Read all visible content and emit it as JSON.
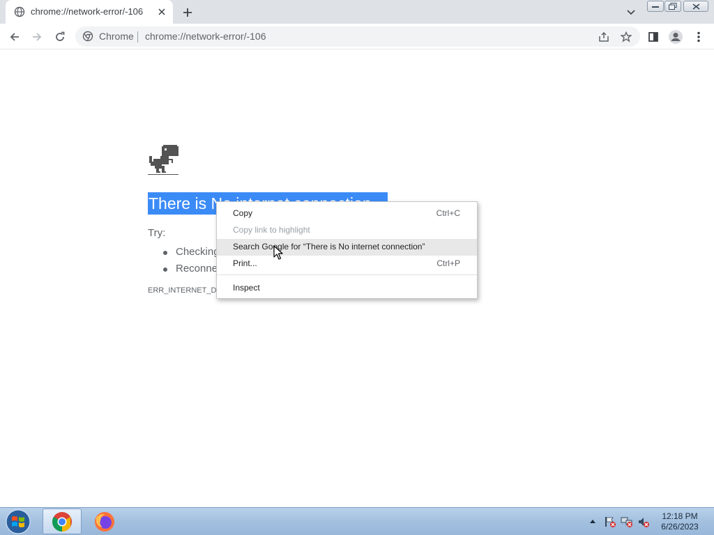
{
  "browser": {
    "tab": {
      "title": "chrome://network-error/-106",
      "favicon": "globe-icon"
    },
    "omnibox": {
      "chip": "Chrome",
      "url": "chrome://network-error/-106"
    },
    "icons": {
      "back": "arrow-left-icon",
      "forward": "arrow-right-icon",
      "reload": "reload-icon",
      "share": "share-icon",
      "bookmark": "star-icon",
      "side_panel": "side-panel-icon",
      "profile": "profile-icon",
      "menu": "kebab-menu-icon"
    }
  },
  "page": {
    "heading": "There is No internet connection",
    "try_label": "Try:",
    "suggestions": [
      "Checking",
      "Reconne"
    ],
    "error_code": "ERR_INTERNET_DIS"
  },
  "context_menu": {
    "items": [
      {
        "label": "Copy",
        "shortcut": "Ctrl+C",
        "state": "normal"
      },
      {
        "label": "Copy link to highlight",
        "shortcut": "",
        "state": "disabled"
      },
      {
        "label": "Search Google for “There is No internet connection”",
        "shortcut": "",
        "state": "hover"
      },
      {
        "label": "Print...",
        "shortcut": "Ctrl+P",
        "state": "normal"
      },
      {
        "label": "Inspect",
        "shortcut": "",
        "state": "normal"
      }
    ]
  },
  "taskbar": {
    "apps": [
      "chrome",
      "firefox"
    ],
    "clock": {
      "time": "12:18 PM",
      "date": "6/26/2023"
    }
  },
  "colors": {
    "selection": "#3b8bf7",
    "tabstrip": "#dee1e6",
    "omnibox": "#f1f3f4",
    "menu_hover": "#e8e8e8"
  }
}
